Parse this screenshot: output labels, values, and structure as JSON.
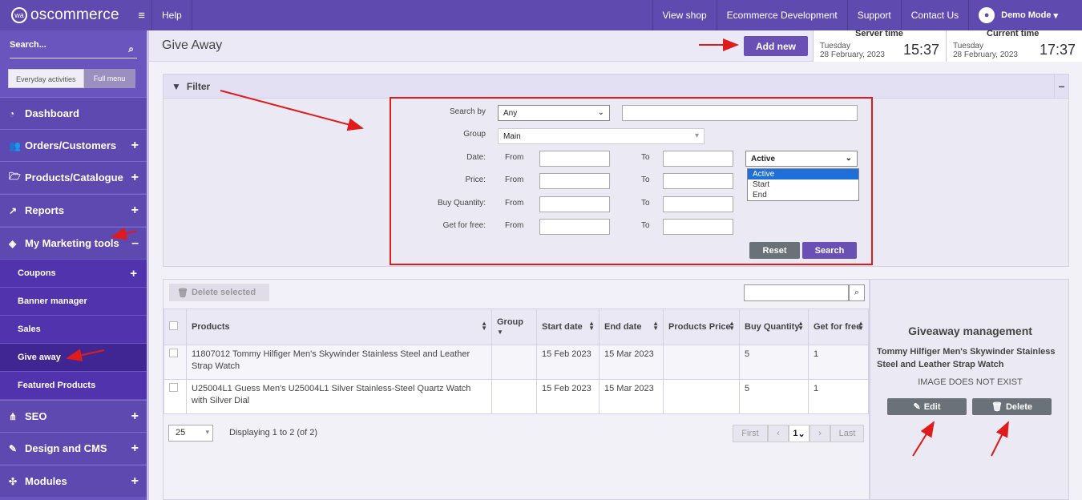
{
  "brand": {
    "name": "oscommerce",
    "logo_mark": "wa"
  },
  "topnav": {
    "help": "Help",
    "view_shop": "View shop",
    "ecommerce": "Ecommerce Development",
    "support": "Support",
    "contact": "Contact Us",
    "user": "Demo Mode"
  },
  "sidebar": {
    "search_placeholder": "Search...",
    "mode_tabs": [
      "Everyday activities",
      "Full menu"
    ],
    "items": [
      {
        "label": "Dashboard",
        "icon": "dashboard-icon",
        "plus": ""
      },
      {
        "label": "Orders/Customers",
        "icon": "users-icon",
        "plus": "+"
      },
      {
        "label": "Products/Catalogue",
        "icon": "folder-icon",
        "plus": "+"
      },
      {
        "label": "Reports",
        "icon": "chart-icon",
        "plus": "+"
      },
      {
        "label": "My Marketing tools",
        "icon": "tag-icon",
        "plus": "–"
      },
      {
        "label": "SEO",
        "icon": "sitemap-icon",
        "plus": "+"
      },
      {
        "label": "Design and CMS",
        "icon": "brush-icon",
        "plus": "+"
      },
      {
        "label": "Modules",
        "icon": "puzzle-icon",
        "plus": "+"
      }
    ],
    "subitems": [
      {
        "label": "Coupons",
        "plus": "+"
      },
      {
        "label": "Banner manager",
        "plus": ""
      },
      {
        "label": "Sales",
        "plus": ""
      },
      {
        "label": "Give away",
        "plus": ""
      },
      {
        "label": "Featured Products",
        "plus": ""
      }
    ]
  },
  "page": {
    "title": "Give Away",
    "add_new": "Add new"
  },
  "server_time": {
    "label": "Server time",
    "day": "Tuesday",
    "date": "28 February, 2023",
    "time": "15:37"
  },
  "current_time": {
    "label": "Current time",
    "day": "Tuesday",
    "date": "28 February, 2023",
    "time": "17:37"
  },
  "filter": {
    "title": "Filter",
    "collapse": "–",
    "search_by_label": "Search by",
    "search_by_value": "Any",
    "group_label": "Group",
    "group_value": "Main",
    "date_label": "Date:",
    "price_label": "Price:",
    "qty_label": "Buy Quantity:",
    "free_label": "Get for free:",
    "from": "From",
    "to": "To",
    "status_value": "Active",
    "status_options": [
      "Active",
      "Start",
      "End"
    ],
    "reset": "Reset",
    "search": "Search"
  },
  "grid": {
    "delete_selected": "Delete selected",
    "columns": [
      "Products",
      "Group",
      "Start date",
      "End date",
      "Products Price",
      "Buy Quantity",
      "Get for free"
    ],
    "rows": [
      {
        "product": "11807012 Tommy Hilfiger Men's Skywinder Stainless Steel and Leather Strap Watch",
        "group": "",
        "start": "15 Feb 2023",
        "end": "15 Mar 2023",
        "price": "",
        "qty": "5",
        "free": "1"
      },
      {
        "product": "U25004L1 Guess Men's U25004L1 Silver Stainless-Steel Quartz Watch with Silver Dial",
        "group": "",
        "start": "15 Feb 2023",
        "end": "15 Mar 2023",
        "price": "",
        "qty": "5",
        "free": "1"
      }
    ],
    "per_page": "25",
    "display_info": "Displaying 1 to 2 (of 2)",
    "first": "First",
    "last": "Last",
    "page": "1"
  },
  "panel": {
    "title": "Giveaway management",
    "product": "Tommy Hilfiger Men's Skywinder Stainless Steel and Leather Strap Watch",
    "image_note": "IMAGE DOES NOT EXIST",
    "edit": "Edit",
    "delete": "Delete"
  },
  "colors": {
    "purple": "#5f4bb0",
    "accent_button": "#6a4fb5",
    "highlight_border": "#e01b1b",
    "gray_button": "#6b7179"
  }
}
